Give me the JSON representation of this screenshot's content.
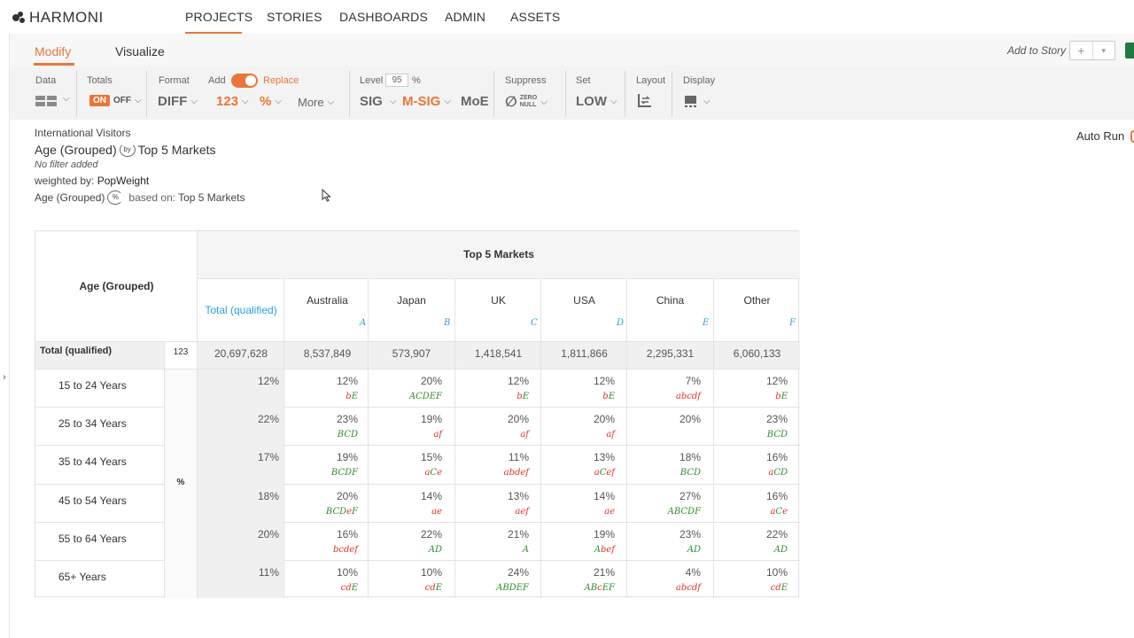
{
  "app": {
    "logo_text": "HARMONI"
  },
  "nav": {
    "items": [
      "PROJECTS",
      "STORIES",
      "DASHBOARDS",
      "ADMIN",
      "ASSETS"
    ],
    "active": "PROJECTS"
  },
  "modes": {
    "modify": "Modify",
    "visualize": "Visualize",
    "active": "Modify"
  },
  "add_to_story": {
    "label": "Add to Story",
    "plus": "+",
    "caret": "▾"
  },
  "toolbar": {
    "data_label": "Data",
    "totals_label": "Totals",
    "totals_on": "ON",
    "totals_off": "OFF",
    "format_label": "Format",
    "format_value": "DIFF",
    "add_label": "Add",
    "replace_label": "Replace",
    "num_value": "123",
    "pct_value": "%",
    "more_label": "More",
    "level_label": "Level",
    "level_value": "95",
    "level_unit": "%",
    "sig": "SIG",
    "msig": "M-SIG",
    "moe": "MoE",
    "suppress_label": "Suppress",
    "zero_top": "ZERO",
    "zero_bottom": "NULL",
    "set_label": "Set",
    "set_value": "LOW",
    "layout_label": "Layout",
    "display_label": "Display"
  },
  "info": {
    "dataset": "International Visitors",
    "row_var": "Age (Grouped)",
    "by": "by",
    "col_var": "Top 5 Markets",
    "filter": "No filter added",
    "weighted_prefix": "weighted by: ",
    "weight": "PopWeight",
    "base_row": "Age (Grouped)",
    "pct_icon": "%",
    "based_on": "based on: ",
    "base_col": "Top 5 Markets"
  },
  "autorun": {
    "label": "Auto Run"
  },
  "table": {
    "row_header": "Age (Grouped)",
    "group_header": "Top 5 Markets",
    "total_col": "Total (qualified)",
    "columns": [
      {
        "name": "Australia",
        "letter": "A"
      },
      {
        "name": "Japan",
        "letter": "B"
      },
      {
        "name": "UK",
        "letter": "C"
      },
      {
        "name": "USA",
        "letter": "D"
      },
      {
        "name": "China",
        "letter": "E"
      },
      {
        "name": "Other",
        "letter": "F"
      }
    ],
    "total_row": {
      "label": "Total (qualified)",
      "stat": "123",
      "total": "20,697,628",
      "values": [
        "8,537,849",
        "573,907",
        "1,418,541",
        "1,811,866",
        "2,295,331",
        "6,060,133"
      ]
    },
    "stat_label": "%",
    "rows": [
      {
        "label": "15 to 24 Years",
        "total": "12%",
        "values": [
          "12%",
          "20%",
          "12%",
          "12%",
          "7%",
          "12%"
        ],
        "sig": [
          [
            "bE",
            "mixed"
          ],
          [
            "ACDEF",
            "green"
          ],
          [
            "bE",
            "mixed"
          ],
          [
            "bE",
            "mixed"
          ],
          [
            "abcdf",
            "red"
          ],
          [
            "bE",
            "mixed"
          ]
        ]
      },
      {
        "label": "25 to 34 Years",
        "total": "22%",
        "values": [
          "23%",
          "19%",
          "20%",
          "20%",
          "20%",
          "23%"
        ],
        "sig": [
          [
            "BCD",
            "green"
          ],
          [
            "af",
            "red"
          ],
          [
            "af",
            "red"
          ],
          [
            "af",
            "red"
          ],
          [
            "",
            ""
          ],
          [
            "BCD",
            "green"
          ]
        ]
      },
      {
        "label": "35 to 44 Years",
        "total": "17%",
        "values": [
          "19%",
          "15%",
          "11%",
          "13%",
          "18%",
          "16%"
        ],
        "sig": [
          [
            "BCDF",
            "green"
          ],
          [
            "aCe",
            "mixed"
          ],
          [
            "abdef",
            "red"
          ],
          [
            "aCef",
            "mixed"
          ],
          [
            "BCD",
            "green"
          ],
          [
            "aCD",
            "mixed"
          ]
        ]
      },
      {
        "label": "45 to 54 Years",
        "total": "18%",
        "values": [
          "20%",
          "14%",
          "13%",
          "14%",
          "27%",
          "16%"
        ],
        "sig": [
          [
            "BCDeF",
            "mixed"
          ],
          [
            "ae",
            "red"
          ],
          [
            "aef",
            "red"
          ],
          [
            "ae",
            "red"
          ],
          [
            "ABCDF",
            "green"
          ],
          [
            "aCe",
            "mixed"
          ]
        ]
      },
      {
        "label": "55 to 64 Years",
        "total": "20%",
        "values": [
          "16%",
          "22%",
          "21%",
          "19%",
          "23%",
          "22%"
        ],
        "sig": [
          [
            "bcdef",
            "red"
          ],
          [
            "AD",
            "green"
          ],
          [
            "A",
            "green"
          ],
          [
            "Abef",
            "mixed"
          ],
          [
            "AD",
            "green"
          ],
          [
            "AD",
            "green"
          ]
        ]
      },
      {
        "label": "65+ Years",
        "total": "11%",
        "values": [
          "10%",
          "10%",
          "24%",
          "21%",
          "4%",
          "10%"
        ],
        "sig": [
          [
            "cdE",
            "mixed"
          ],
          [
            "cdE",
            "mixed"
          ],
          [
            "ABDEF",
            "green"
          ],
          [
            "ABcEF",
            "mixed"
          ],
          [
            "abcdf",
            "red"
          ],
          [
            "cdE",
            "mixed"
          ]
        ]
      }
    ]
  },
  "colors": {
    "accent": "#e8763a",
    "link_blue": "#2a9fd6",
    "sig_up": "#2e8b2e",
    "sig_down": "#d9342b"
  }
}
